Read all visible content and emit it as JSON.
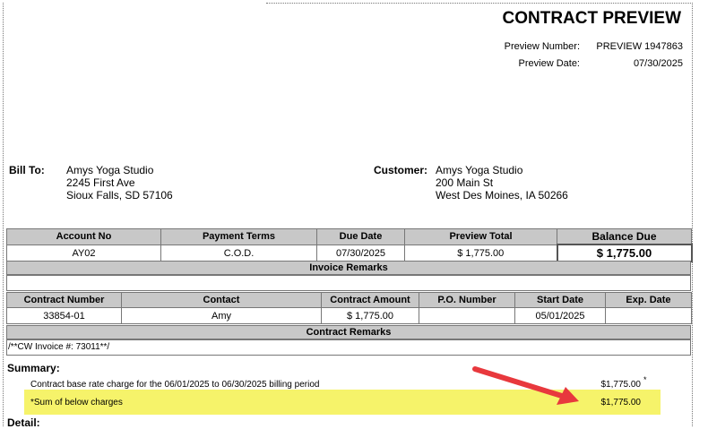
{
  "header": {
    "title": "CONTRACT PREVIEW",
    "preview_number_label": "Preview Number:",
    "preview_number": "PREVIEW 1947863",
    "preview_date_label": "Preview Date:",
    "preview_date": "07/30/2025"
  },
  "bill_to": {
    "label": "Bill To:",
    "lines": [
      "Amys Yoga Studio",
      "2245 First Ave",
      "Sioux Falls, SD  57106"
    ]
  },
  "customer": {
    "label": "Customer:",
    "lines": [
      "Amys Yoga Studio",
      "200 Main St",
      "West Des Moines, IA  50266"
    ]
  },
  "account_table": {
    "headers": [
      "Account No",
      "Payment Terms",
      "Due Date",
      "Preview Total",
      "Balance Due"
    ],
    "values": [
      "AY02",
      "C.O.D.",
      "07/30/2025",
      "$ 1,775.00",
      "$  1,775.00"
    ]
  },
  "invoice_remarks_label": "Invoice Remarks",
  "contract_table": {
    "headers": [
      "Contract Number",
      "Contact",
      "Contract Amount",
      "P.O. Number",
      "Start Date",
      "Exp. Date"
    ],
    "values": [
      "33854-01",
      "Amy",
      "$ 1,775.00",
      "",
      "05/01/2025",
      ""
    ]
  },
  "contract_remarks_label": "Contract Remarks",
  "contract_remarks_text": "/**CW Invoice #: 73011**/",
  "summary": {
    "label": "Summary:",
    "line_text": "Contract base rate charge for the 06/01/2025 to 06/30/2025 billing period",
    "line_amount": "$1,775.00",
    "line_marker": "*",
    "sum_text": "*Sum of below charges",
    "sum_amount": "$1,775.00"
  },
  "detail_label": "Detail:",
  "colors": {
    "header_gray": "#c8c8c8",
    "highlight_yellow": "#f6f36a",
    "arrow_red": "#e8383d"
  }
}
